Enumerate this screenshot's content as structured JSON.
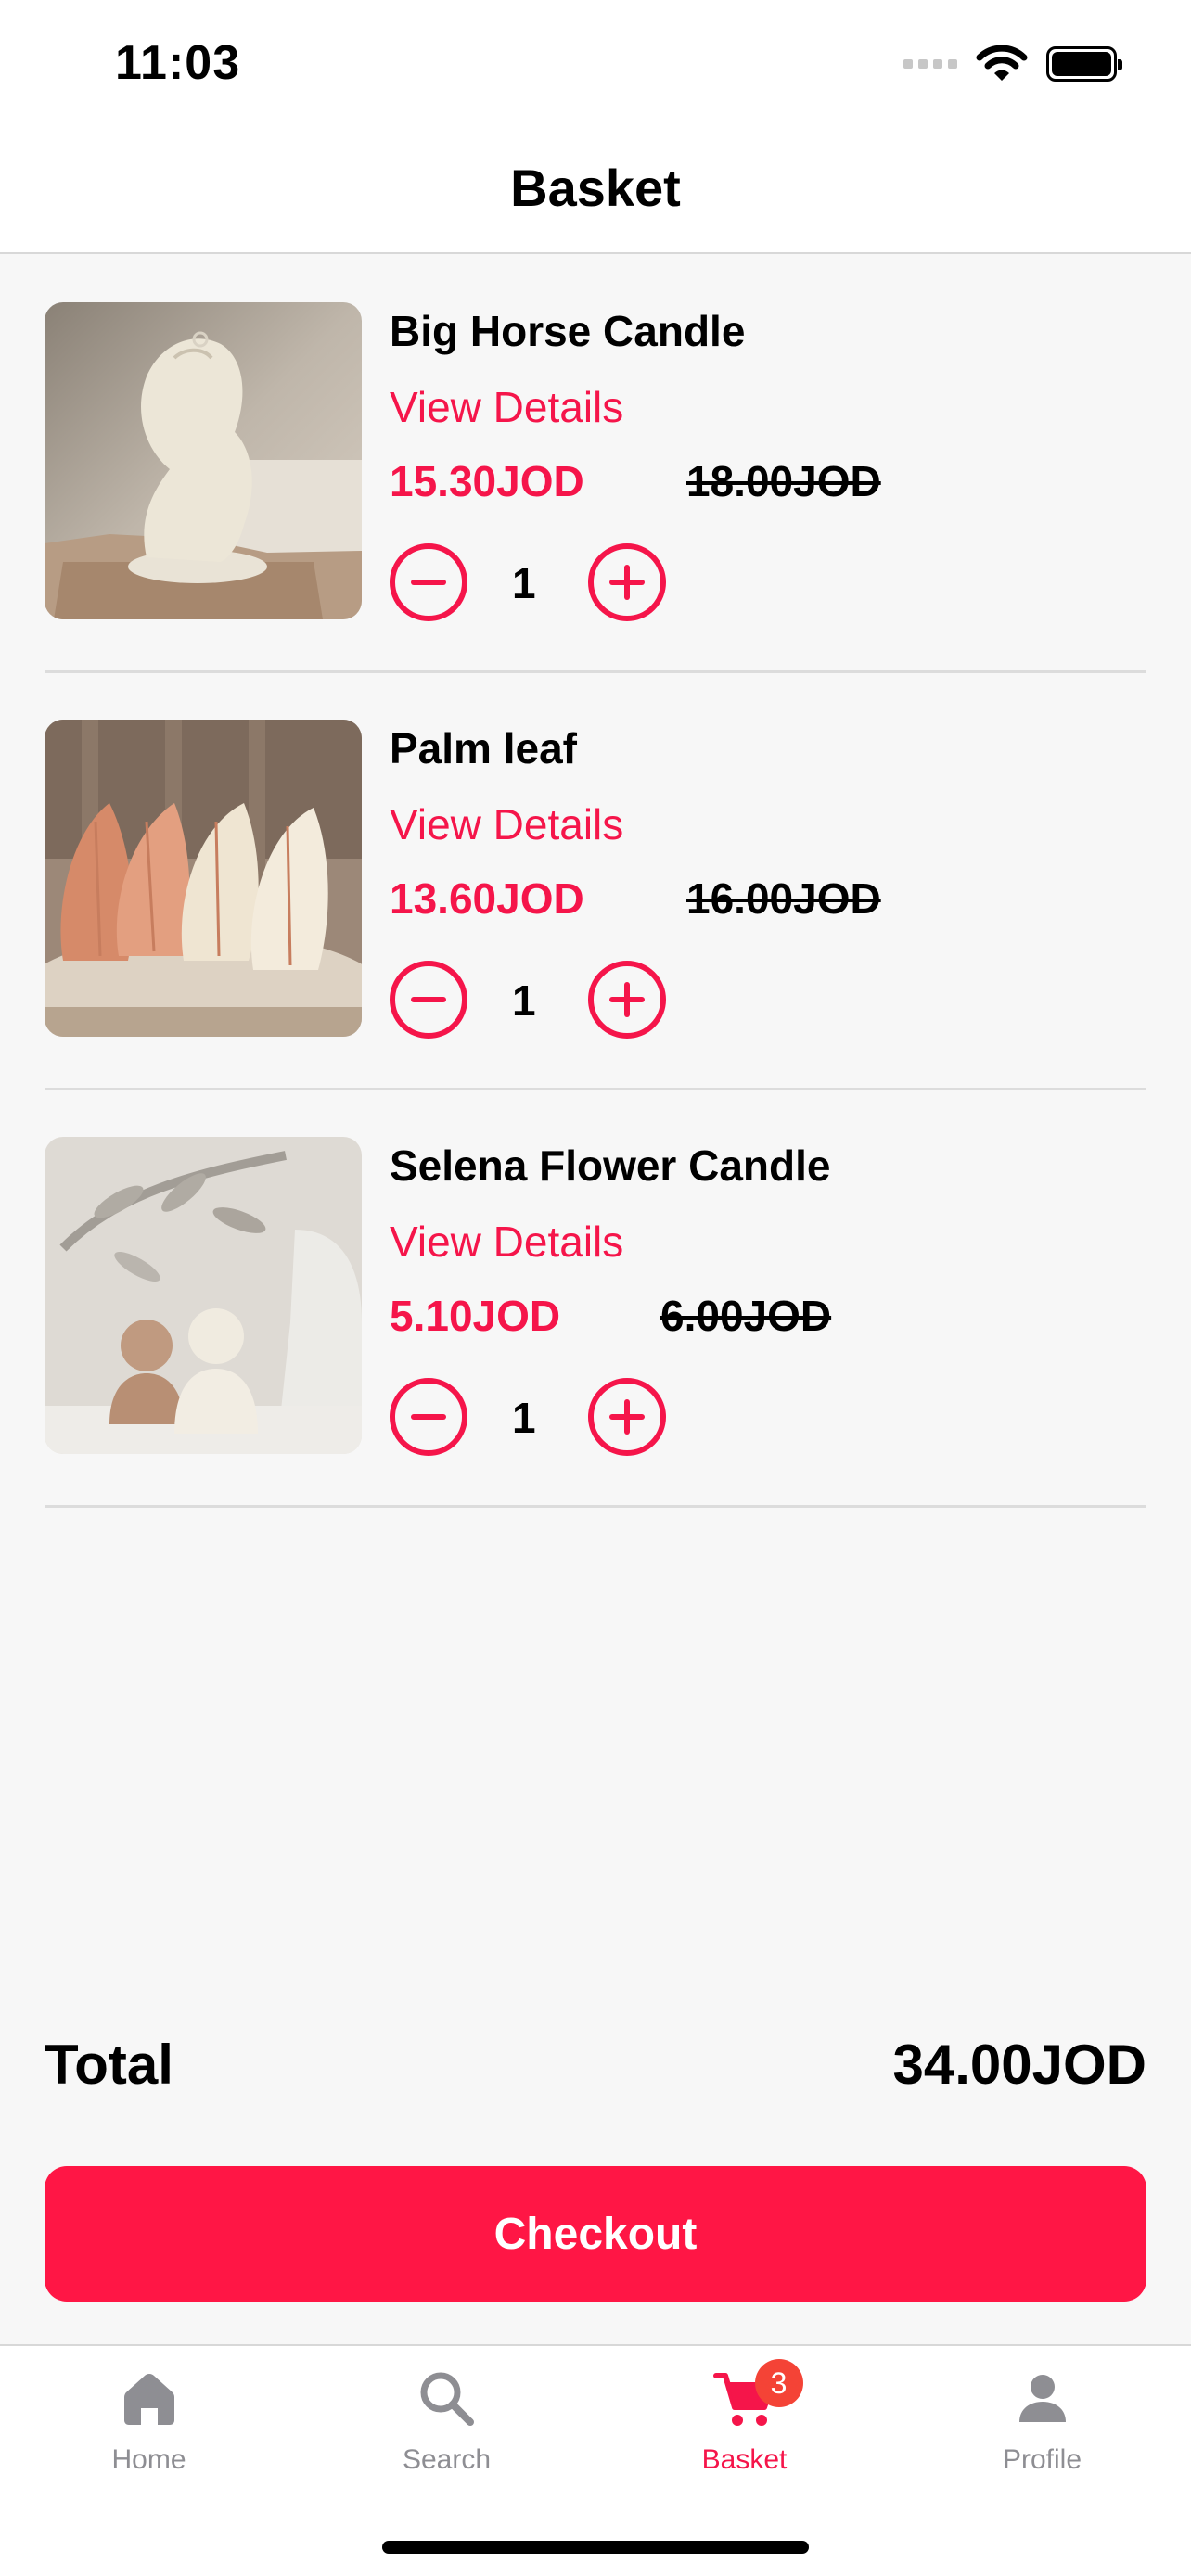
{
  "status_bar": {
    "time": "11:03"
  },
  "header": {
    "title": "Basket"
  },
  "items": [
    {
      "name": "Big Horse Candle",
      "details_label": "View Details",
      "price": "15.30JOD",
      "old_price": "18.00JOD",
      "quantity": "1"
    },
    {
      "name": "Palm leaf",
      "details_label": "View Details",
      "price": "13.60JOD",
      "old_price": "16.00JOD",
      "quantity": "1"
    },
    {
      "name": "Selena Flower Candle",
      "details_label": "View Details",
      "price": "5.10JOD",
      "old_price": "6.00JOD",
      "quantity": "1"
    }
  ],
  "total": {
    "label": "Total",
    "value": "34.00JOD"
  },
  "checkout": {
    "label": "Checkout"
  },
  "tabs": [
    {
      "label": "Home",
      "icon": "home-icon"
    },
    {
      "label": "Search",
      "icon": "search-icon"
    },
    {
      "label": "Basket",
      "icon": "cart-icon",
      "badge": "3",
      "active": true
    },
    {
      "label": "Profile",
      "icon": "person-icon"
    }
  ],
  "colors": {
    "accent": "#f5154a",
    "checkout": "#ff1645",
    "badge": "#f44336",
    "inactive_tab": "#8e8e93"
  }
}
